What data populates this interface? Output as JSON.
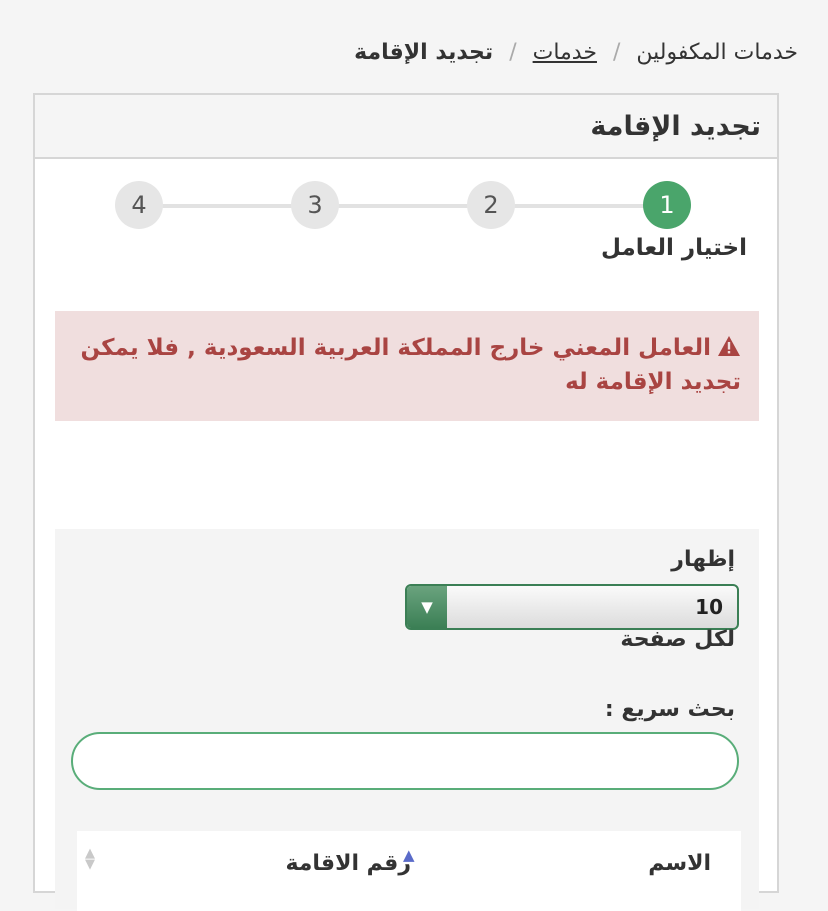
{
  "breadcrumb": {
    "root": "خدمات المكفولين",
    "separator": "/",
    "services": "خدمات",
    "current": "تجديد الإقامة"
  },
  "panel": {
    "title": "تجديد الإقامة"
  },
  "stepper": {
    "steps": [
      "1",
      "2",
      "3",
      "4"
    ],
    "active_step": 1,
    "active_label": "اختيار العامل",
    "active_color": "#4aa56b"
  },
  "alert": {
    "icon": "warning-icon",
    "message": "العامل المعني خارج المملكة العربية السعودية , فلا يمكن تجديد الإقامة له",
    "background": "#f0dede",
    "text_color": "#a94442"
  },
  "filters": {
    "show_label": "إظهار",
    "page_size_value": "10",
    "per_page_label": "لكل صفحة",
    "search_label": "بحث سريع :",
    "search_value": ""
  },
  "table": {
    "columns": [
      "الاسم",
      "رقم الاقامة"
    ]
  }
}
